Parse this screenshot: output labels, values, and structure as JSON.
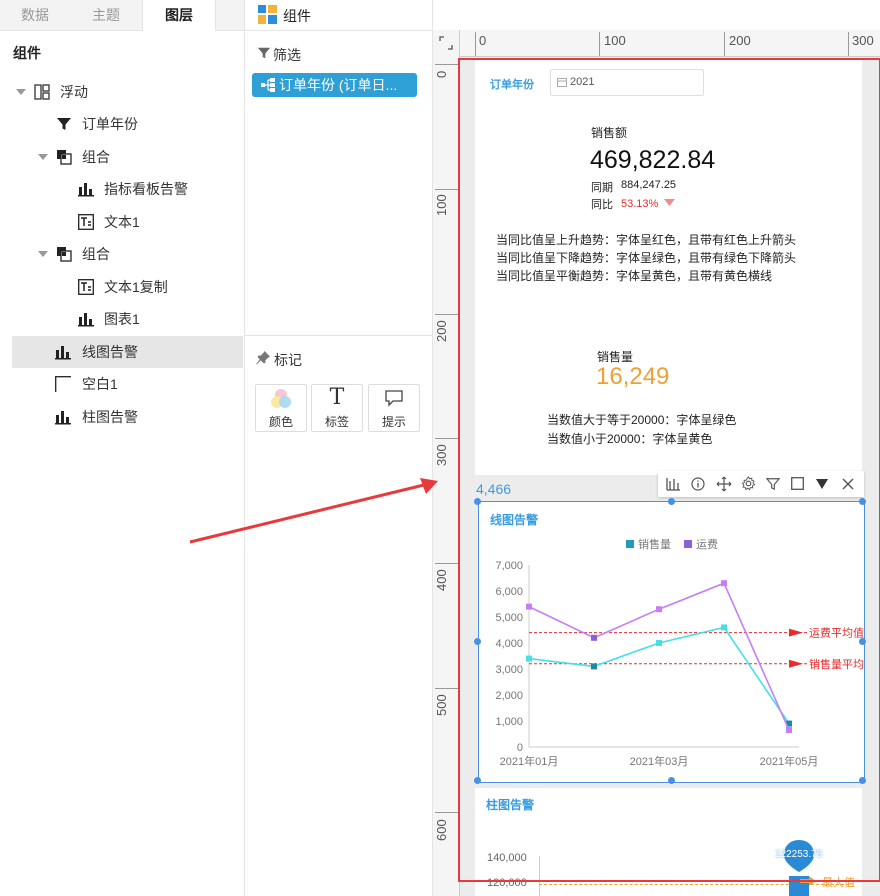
{
  "tabs": [
    "数据",
    "主题",
    "图层"
  ],
  "components_title": "组件",
  "tree": [
    {
      "label": "浮动"
    },
    {
      "label": "订单年份"
    },
    {
      "label": "组合"
    },
    {
      "label": "指标看板告警"
    },
    {
      "label": "文本1"
    },
    {
      "label": "组合"
    },
    {
      "label": "文本1复制"
    },
    {
      "label": "图表1"
    },
    {
      "label": "线图告警"
    },
    {
      "label": "空白1"
    },
    {
      "label": "柱图告警"
    }
  ],
  "mid": {
    "title": "组件",
    "filter_title": "筛选",
    "filter_chip": "订单年份 (订单日...",
    "mark_title": "标记",
    "marks": [
      "颜色",
      "标签",
      "提示"
    ]
  },
  "ruler": {
    "h": [
      "0",
      "100",
      "200",
      "300"
    ],
    "v": [
      "0",
      "100",
      "200",
      "300",
      "400",
      "500",
      "600"
    ]
  },
  "canvas": {
    "year_label": "订单年份",
    "year_value": "2021",
    "kpi1_title": "销售额",
    "kpi1_value": "469,822.84",
    "kpi1_prev_label": "同期",
    "kpi1_prev_value": "884,247.25",
    "kpi1_yoy_label": "同比",
    "kpi1_yoy_value": "53.13%",
    "rules1": [
      "当同比值呈上升趋势：字体呈红色，且带有红色上升箭头",
      "当同比值呈下降趋势：字体呈绿色，且带有绿色下降箭头",
      "当同比值呈平衡趋势：字体呈黄色，且带有黄色横线"
    ],
    "kpi2_title": "销售量",
    "kpi2_value": "16,249",
    "rules2": [
      "当数值大于等于20000：字体呈绿色",
      "当数值小于20000：字体呈黄色"
    ],
    "selected_y": "4,466",
    "line_title": "线图告警",
    "bar_title": "柱图告警",
    "bar_axis": [
      "140,000",
      "120,000"
    ],
    "bar_pin": "122253.75",
    "bar_max_label": "最大值"
  },
  "chart_data": {
    "type": "line",
    "title": "线图告警",
    "categories": [
      "2021年01月",
      "2021年02月",
      "2021年03月",
      "2021年04月",
      "2021年05月"
    ],
    "series": [
      {
        "name": "销售量",
        "values": [
          3400,
          3100,
          4000,
          4600,
          900
        ],
        "color": "#44e0e8"
      },
      {
        "name": "运费",
        "values": [
          5400,
          4200,
          5300,
          6300,
          650
        ],
        "color": "#c77df5"
      }
    ],
    "yticks": [
      "7,000",
      "6,000",
      "5,000",
      "4,000",
      "3,000",
      "2,000",
      "1,000",
      "0"
    ],
    "xticks": [
      "2021年01月",
      "2021年03月",
      "2021年05月"
    ],
    "ylim": [
      0,
      7000
    ],
    "reference_lines": [
      {
        "label": "运费平均值",
        "value": 4400
      },
      {
        "label": "销售量平均值",
        "value": 3200
      }
    ],
    "legend_position": "top-center",
    "ref_color": "#e82b2b"
  },
  "colors": {
    "accent": "#3a9de0",
    "chip": "#2fa0d6",
    "orange": "#f0a030",
    "red_frame": "#e83a3a",
    "ref_red": "#e82b2b"
  }
}
